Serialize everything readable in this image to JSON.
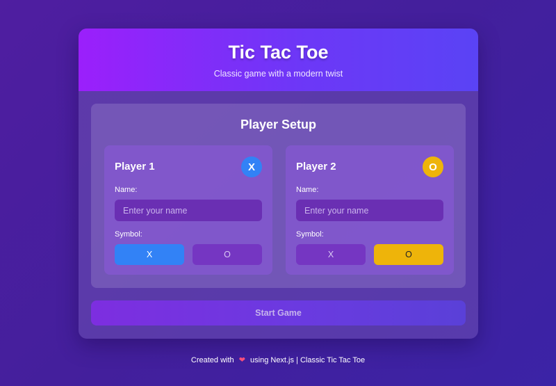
{
  "header": {
    "title": "Tic Tac Toe",
    "subtitle": "Classic game with a modern twist"
  },
  "setup": {
    "title": "Player Setup",
    "players": [
      {
        "name": "Player 1",
        "badge": "X",
        "badge_color": "#3282f6",
        "name_label": "Name:",
        "name_placeholder": "Enter your name",
        "name_value": "",
        "symbol_label": "Symbol:",
        "symbol_options": [
          "X",
          "O"
        ],
        "selected_symbol": "X"
      },
      {
        "name": "Player 2",
        "badge": "O",
        "badge_color": "#eeb40a",
        "name_label": "Name:",
        "name_placeholder": "Enter your name",
        "name_value": "",
        "symbol_label": "Symbol:",
        "symbol_options": [
          "X",
          "O"
        ],
        "selected_symbol": "O"
      }
    ]
  },
  "start_button": "Start Game",
  "footer": {
    "prefix": "Created with",
    "heart_icon": "heart-icon",
    "suffix": "using Next.js | Classic Tic Tac Toe"
  }
}
